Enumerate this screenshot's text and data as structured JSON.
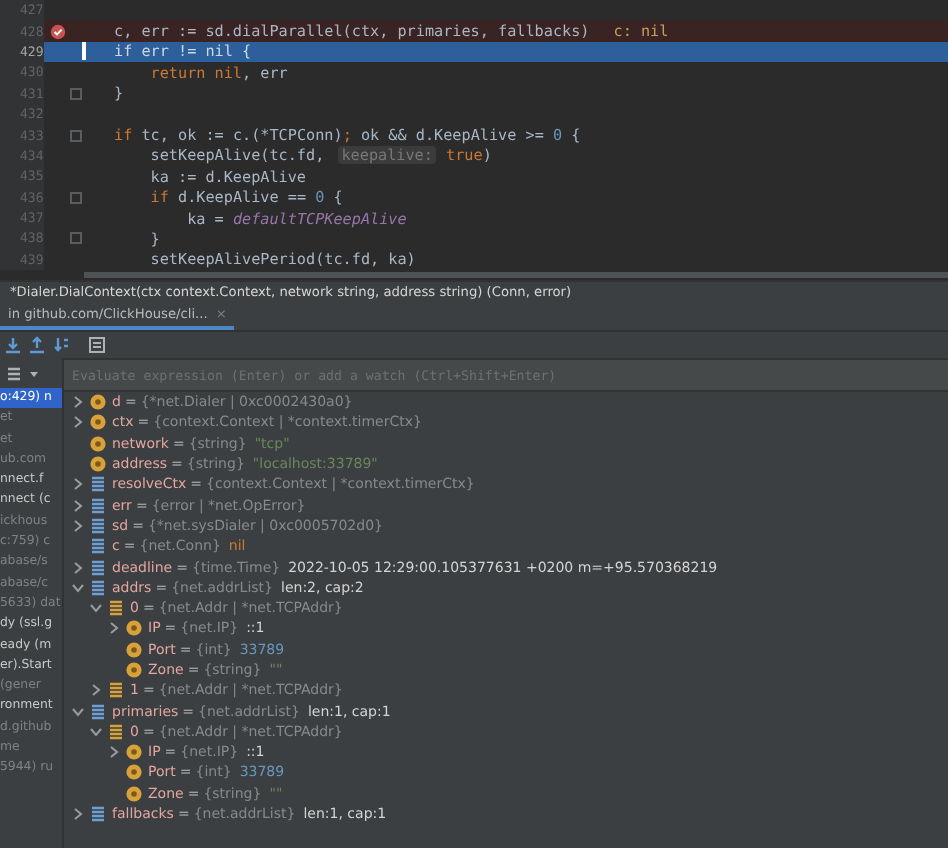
{
  "editor": {
    "lines": [
      {
        "number": "427",
        "breakpoint": false,
        "current": false,
        "fold_mark": false
      },
      {
        "number": "428",
        "breakpoint": true,
        "current": false,
        "fold_mark": false,
        "tokens": [
          {
            "text": "c, err := sd.dialParallel(ctx, primaries, fallbacks)",
            "kind": "plain"
          },
          {
            "text": "c: nil",
            "kind": "inline_value"
          }
        ]
      },
      {
        "number": "429",
        "breakpoint": false,
        "current": true,
        "fold_mark": false,
        "tokens": [
          {
            "text": "if",
            "kind": "kw"
          },
          {
            "text": " err != ",
            "kind": "plain"
          },
          {
            "text": "nil",
            "kind": "kw"
          },
          {
            "text": " {",
            "kind": "plain"
          }
        ]
      },
      {
        "number": "430",
        "breakpoint": false,
        "current": false,
        "fold_mark": false,
        "tokens": [
          {
            "text": "    return",
            "kind": "kw"
          },
          {
            "text": " nil",
            "kind": "kw"
          },
          {
            "text": ", err",
            "kind": "plain"
          }
        ]
      },
      {
        "number": "431",
        "breakpoint": false,
        "current": false,
        "fold_mark": true,
        "tokens": [
          {
            "text": "}",
            "kind": "plain"
          }
        ]
      },
      {
        "number": "432",
        "breakpoint": false,
        "current": false,
        "fold_mark": false
      },
      {
        "number": "433",
        "breakpoint": false,
        "current": false,
        "fold_mark": true,
        "tokens": [
          {
            "text": "if",
            "kind": "kw"
          },
          {
            "text": " tc, ok := c.(*TCPConn)",
            "kind": "plain"
          },
          {
            "text": ";",
            "kind": "kw"
          },
          {
            "text": " ok && d.KeepAlive >= ",
            "kind": "plain"
          },
          {
            "text": "0",
            "kind": "num"
          },
          {
            "text": " {",
            "kind": "plain"
          }
        ]
      },
      {
        "number": "434",
        "breakpoint": false,
        "current": false,
        "fold_mark": false,
        "tokens": [
          {
            "text": "    setKeepAlive(tc.fd, ",
            "kind": "plain"
          },
          {
            "text": "keepalive:",
            "kind": "hint"
          },
          {
            "text": " true",
            "kind": "kw"
          },
          {
            "text": ")",
            "kind": "plain"
          }
        ]
      },
      {
        "number": "435",
        "breakpoint": false,
        "current": false,
        "fold_mark": false,
        "tokens": [
          {
            "text": "    ka := d.KeepAlive",
            "kind": "plain"
          }
        ]
      },
      {
        "number": "436",
        "breakpoint": false,
        "current": false,
        "fold_mark": true,
        "tokens": [
          {
            "text": "    if",
            "kind": "kw"
          },
          {
            "text": " d.KeepAlive == ",
            "kind": "plain"
          },
          {
            "text": "0",
            "kind": "num"
          },
          {
            "text": " {",
            "kind": "plain"
          }
        ]
      },
      {
        "number": "437",
        "breakpoint": false,
        "current": false,
        "fold_mark": false,
        "tokens": [
          {
            "text": "        ka = ",
            "kind": "plain"
          },
          {
            "text": "defaultTCPKeepAlive",
            "kind": "const"
          }
        ]
      },
      {
        "number": "438",
        "breakpoint": false,
        "current": false,
        "fold_mark": true,
        "tokens": [
          {
            "text": "    }",
            "kind": "plain"
          }
        ]
      },
      {
        "number": "439",
        "breakpoint": false,
        "current": false,
        "fold_mark": false,
        "tokens": [
          {
            "text": "    setKeepAlivePeriod(tc.fd, ka)",
            "kind": "plain"
          }
        ]
      }
    ]
  },
  "signature_hint": "*Dialer.DialContext(ctx context.Context, network string, address string) (Conn, error)",
  "debug_tab": {
    "label": "in github.com/ClickHouse/cli...",
    "close": "×",
    "selected": true
  },
  "evaluate": {
    "placeholder": "Evaluate expression (Enter) or add a watch (Ctrl+Shift+Enter)"
  },
  "frames": [
    {
      "text": "o:429) n",
      "selected": true,
      "dimmed": false
    },
    {
      "text": "et",
      "selected": false,
      "dimmed": true
    },
    {
      "text": "et",
      "selected": false,
      "dimmed": true
    },
    {
      "text": "ub.com",
      "selected": false,
      "dimmed": true
    },
    {
      "text": "nnect.f",
      "selected": false,
      "dimmed": false
    },
    {
      "text": "nnect (c",
      "selected": false,
      "dimmed": false
    },
    {
      "text": "ickhous",
      "selected": false,
      "dimmed": true
    },
    {
      "text": "c:759) c",
      "selected": false,
      "dimmed": true
    },
    {
      "text": "abase/s",
      "selected": false,
      "dimmed": true
    },
    {
      "text": "abase/c",
      "selected": false,
      "dimmed": true
    },
    {
      "text": "5633) dat",
      "selected": false,
      "dimmed": true
    },
    {
      "text": "dy (ssl.g",
      "selected": false,
      "dimmed": false
    },
    {
      "text": "eady (m",
      "selected": false,
      "dimmed": false
    },
    {
      "text": "er).Start",
      "selected": false,
      "dimmed": false
    },
    {
      "text": "(gener",
      "selected": false,
      "dimmed": true
    },
    {
      "text": "ronment",
      "selected": false,
      "dimmed": false
    },
    {
      "text": "d.github",
      "selected": false,
      "dimmed": true
    },
    {
      "text": "me",
      "selected": false,
      "dimmed": true
    },
    {
      "text": "5944) ru",
      "selected": false,
      "dimmed": true
    }
  ],
  "variables": [
    {
      "expandable": true,
      "expanded": false,
      "kind": "param",
      "name": "d",
      "sep": "=",
      "type": "{*net.Dialer | 0xc0002430a0}"
    },
    {
      "expandable": true,
      "expanded": false,
      "kind": "param",
      "name": "ctx",
      "sep": "=",
      "type": "{context.Context | *context.timerCtx}"
    },
    {
      "expandable": false,
      "kind": "param",
      "name": "network",
      "sep": "=",
      "type": "{string}",
      "value": "\"tcp\"",
      "color": "#6a8759"
    },
    {
      "expandable": false,
      "kind": "param",
      "name": "address",
      "sep": "=",
      "type": "{string}",
      "value": "\"localhost:33789\"",
      "color": "#6a8759"
    },
    {
      "expandable": true,
      "expanded": false,
      "kind": "local",
      "name": "resolveCtx",
      "sep": "=",
      "type": "{context.Context | *context.timerCtx}"
    },
    {
      "expandable": true,
      "expanded": false,
      "kind": "local",
      "name": "err",
      "sep": "=",
      "type": "{error | *net.OpError}"
    },
    {
      "expandable": true,
      "expanded": false,
      "kind": "local",
      "name": "sd",
      "sep": "=",
      "type": "{*net.sysDialer | 0xc0005702d0}"
    },
    {
      "expandable": false,
      "kind": "local",
      "name": "c",
      "sep": "=",
      "type": "{net.Conn}",
      "value": "nil",
      "color": "#cc7832"
    },
    {
      "expandable": true,
      "expanded": false,
      "kind": "local",
      "name": "deadline",
      "sep": "=",
      "type": "{time.Time}",
      "value": "2022-10-05 12:29:00.105377631 +0200 m=+95.570368219",
      "color": "#d4d4d4"
    },
    {
      "expandable": true,
      "expanded": true,
      "kind": "local",
      "name": "addrs",
      "sep": "=",
      "type": "{net.addrList}",
      "value": "len:2, cap:2",
      "color": "#d4d4d4",
      "children": [
        {
          "expandable": true,
          "expanded": true,
          "kind": "element",
          "name": "0",
          "sep": "=",
          "type": "{net.Addr | *net.TCPAddr}",
          "children": [
            {
              "expandable": true,
              "expanded": false,
              "kind": "field",
              "name": "IP",
              "sep": "=",
              "type": "{net.IP}",
              "value": "::1",
              "color": "#d4d4d4"
            },
            {
              "expandable": false,
              "kind": "field",
              "name": "Port",
              "sep": "=",
              "type": "{int}",
              "value": "33789",
              "color": "#6897bb"
            },
            {
              "expandable": false,
              "kind": "field",
              "name": "Zone",
              "sep": "=",
              "type": "{string}",
              "value": "\"\"",
              "color": "#6a8759"
            }
          ]
        },
        {
          "expandable": true,
          "expanded": false,
          "kind": "element",
          "name": "1",
          "sep": "=",
          "type": "{net.Addr | *net.TCPAddr}"
        }
      ]
    },
    {
      "expandable": true,
      "expanded": true,
      "kind": "local",
      "name": "primaries",
      "sep": "=",
      "type": "{net.addrList}",
      "value": "len:1, cap:1",
      "color": "#d4d4d4",
      "children": [
        {
          "expandable": true,
          "expanded": true,
          "kind": "element",
          "name": "0",
          "sep": "=",
          "type": "{net.Addr | *net.TCPAddr}",
          "children": [
            {
              "expandable": true,
              "expanded": false,
              "kind": "field",
              "name": "IP",
              "sep": "=",
              "type": "{net.IP}",
              "value": "::1",
              "color": "#d4d4d4"
            },
            {
              "expandable": false,
              "kind": "field",
              "name": "Port",
              "sep": "=",
              "type": "{int}",
              "value": "33789",
              "color": "#6897bb"
            },
            {
              "expandable": false,
              "kind": "field",
              "name": "Zone",
              "sep": "=",
              "type": "{string}",
              "value": "\"\"",
              "color": "#6a8759"
            }
          ]
        }
      ]
    },
    {
      "expandable": true,
      "expanded": false,
      "kind": "local",
      "name": "fallbacks",
      "sep": "=",
      "type": "{net.addrList}",
      "value": "len:1, cap:1",
      "color": "#d4d4d4"
    }
  ]
}
